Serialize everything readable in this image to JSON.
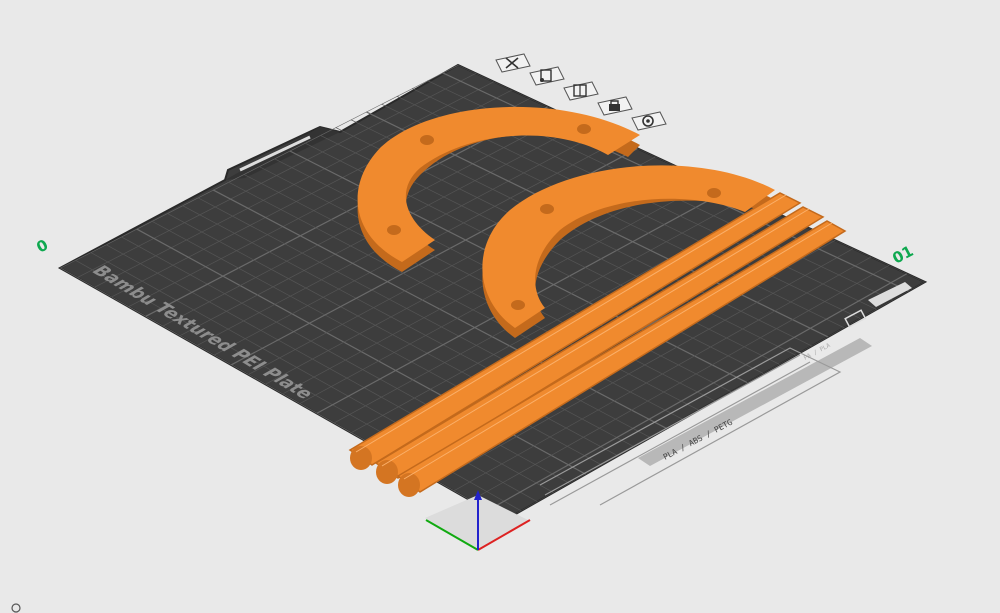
{
  "plate": {
    "name": "Bambu Textured PEI Plate",
    "number_left": "0",
    "number_right": "01",
    "filament_text": "PLA / ABS / PETG",
    "small_label": "PA / PLA"
  },
  "toolbar": {
    "items": [
      {
        "name": "delete-plate",
        "icon": "x-icon"
      },
      {
        "name": "auto-orient",
        "icon": "orient-icon"
      },
      {
        "name": "arrange",
        "icon": "arrange-icon"
      },
      {
        "name": "lock",
        "icon": "lock-icon"
      },
      {
        "name": "plate-settings",
        "icon": "gear-icon"
      }
    ]
  },
  "colors": {
    "plate_dark": "#3f3f3f",
    "grid_line": "#585858",
    "model": "#f08a2e",
    "model_shade": "#c46a1c",
    "background": "#e9e9e9",
    "axis_x": "#d22",
    "axis_y": "#1a1",
    "axis_z": "#22c",
    "accent": "#0ea84f"
  },
  "gizmo": {
    "axes": [
      "x-axis",
      "y-axis",
      "z-axis"
    ]
  }
}
